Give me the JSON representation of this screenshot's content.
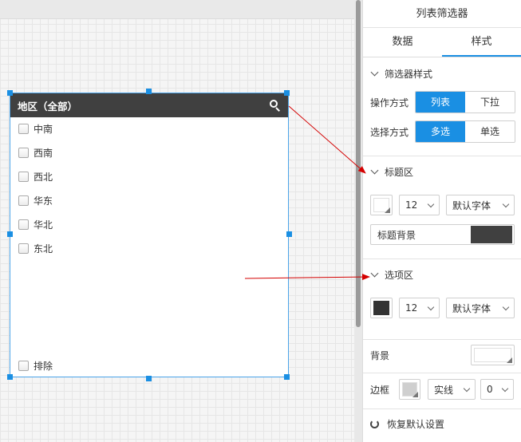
{
  "widget": {
    "header_title": "地区（全部）",
    "options": [
      "中南",
      "西南",
      "西北",
      "华东",
      "华北",
      "东北"
    ],
    "exclude_label": "排除"
  },
  "panel": {
    "title": "列表筛选器",
    "tabs": [
      {
        "label": "数据",
        "active": false
      },
      {
        "label": "样式",
        "active": true
      }
    ],
    "filter_style": {
      "heading": "筛选器样式",
      "operation_mode_label": "操作方式",
      "operation_options": [
        "列表",
        "下拉"
      ],
      "operation_selected": "列表",
      "select_mode_label": "选择方式",
      "select_options": [
        "多选",
        "单选"
      ],
      "select_selected": "多选"
    },
    "title_area": {
      "heading": "标题区",
      "font_size": "12",
      "font_family": "默认字体",
      "bg_label": "标题背景",
      "bg_color": "#404040"
    },
    "option_area": {
      "heading": "选项区",
      "font_size": "12",
      "font_family": "默认字体",
      "swatch_color": "#333333"
    },
    "background_label": "背景",
    "border": {
      "label": "边框",
      "style": "实线",
      "width": "0"
    },
    "reset_label": "恢复默认设置"
  },
  "colors": {
    "accent": "#1a8fe3",
    "header_bg": "#404040",
    "arrow": "#d40000"
  }
}
